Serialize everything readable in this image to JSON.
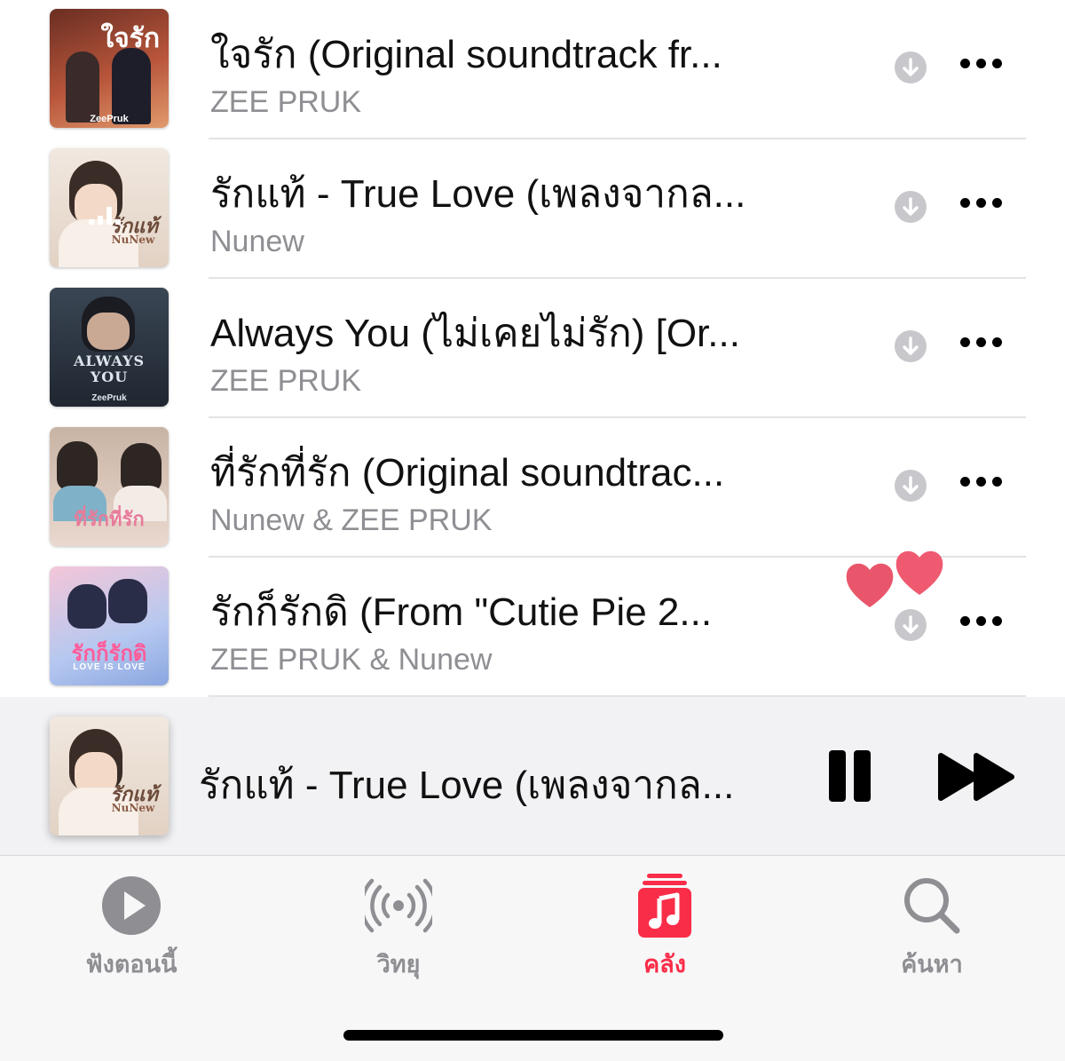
{
  "tracks": [
    {
      "title": "ใจรัก (Original soundtrack fr...",
      "artist": "ZEE PRUK",
      "art_text": "ใจรัก",
      "art_sub": "ZeePruk",
      "art_bg": "#b24a34"
    },
    {
      "title": "รักแท้ - True Love (เพลงจากล...",
      "artist": "Nunew",
      "art_text": "รักแท้",
      "art_sub": "NuNew",
      "art_bg": "#e8dcd2"
    },
    {
      "title": "Always You (ไม่เคยไม่รัก) [Or...",
      "artist": "ZEE PRUK",
      "art_text": "ALWAYS YOU",
      "art_sub": "ZeePruk",
      "art_bg": "#2a3340"
    },
    {
      "title": "ที่รักที่รัก (Original soundtrac...",
      "artist": "Nunew & ZEE PRUK",
      "art_text": "ที่รักที่รัก",
      "art_sub": "",
      "art_bg": "#d8c4b8"
    },
    {
      "title": "รักก็รักดิ (From \"Cutie Pie 2...",
      "artist": "ZEE PRUK & Nunew",
      "art_text": "รักก็รักดิ",
      "art_sub": "LOVE IS LOVE",
      "art_bg": "#9fb7e6"
    }
  ],
  "now_playing": {
    "title": "รักแท้ - True Love (เพลงจากล...",
    "art_text": "รักแท้",
    "art_sub": "NuNew"
  },
  "tabs": [
    {
      "label": "ฟังตอนนี้",
      "icon": "play-circle-icon",
      "active": false
    },
    {
      "label": "วิทยุ",
      "icon": "radio-icon",
      "active": false
    },
    {
      "label": "คลัง",
      "icon": "library-icon",
      "active": true
    },
    {
      "label": "ค้นหา",
      "icon": "search-icon",
      "active": false
    }
  ],
  "colors": {
    "accent": "#fa2d48",
    "secondary_text": "#8e8e93",
    "heart": "#e8566a"
  }
}
